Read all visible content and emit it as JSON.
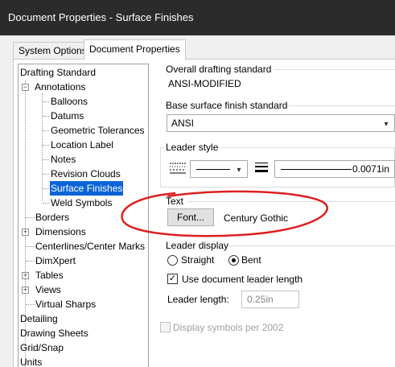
{
  "window": {
    "title": "Document Properties - Surface Finishes"
  },
  "tabs": [
    {
      "label": "System Options",
      "active": false
    },
    {
      "label": "Document Properties",
      "active": true
    }
  ],
  "tree": {
    "items": [
      {
        "label": "Drafting Standard"
      },
      {
        "label": "Annotations",
        "expanded": true
      },
      {
        "label": "Balloons"
      },
      {
        "label": "Datums"
      },
      {
        "label": "Geometric Tolerances"
      },
      {
        "label": "Location Label"
      },
      {
        "label": "Notes"
      },
      {
        "label": "Revision Clouds"
      },
      {
        "label": "Surface Finishes",
        "selected": true
      },
      {
        "label": "Weld Symbols"
      },
      {
        "label": "Borders"
      },
      {
        "label": "Dimensions",
        "expanded": false
      },
      {
        "label": "Centerlines/Center Marks"
      },
      {
        "label": "DimXpert"
      },
      {
        "label": "Tables",
        "expanded": false
      },
      {
        "label": "Views",
        "expanded": false
      },
      {
        "label": "Virtual Sharps"
      },
      {
        "label": "Detailing"
      },
      {
        "label": "Drawing Sheets"
      },
      {
        "label": "Grid/Snap"
      },
      {
        "label": "Units"
      }
    ]
  },
  "overall": {
    "label": "Overall drafting standard",
    "value": "ANSI-MODIFIED"
  },
  "base": {
    "label": "Base surface finish standard",
    "value": "ANSI"
  },
  "leader_style": {
    "label": "Leader style",
    "thickness_value": "0.0071in"
  },
  "text": {
    "label": "Text",
    "font_button": "Font...",
    "font_name": "Century Gothic"
  },
  "leader_display": {
    "label": "Leader display",
    "straight": "Straight",
    "bent": "Bent",
    "selected": "Bent",
    "use_doc_length": "Use document leader length",
    "use_doc_length_checked": true,
    "length_label": "Leader length:",
    "length_value": "0.25in"
  },
  "display_2002": {
    "label": "Display symbols per 2002",
    "checked": false,
    "enabled": false
  },
  "annotation_color": "#dd1f1f"
}
